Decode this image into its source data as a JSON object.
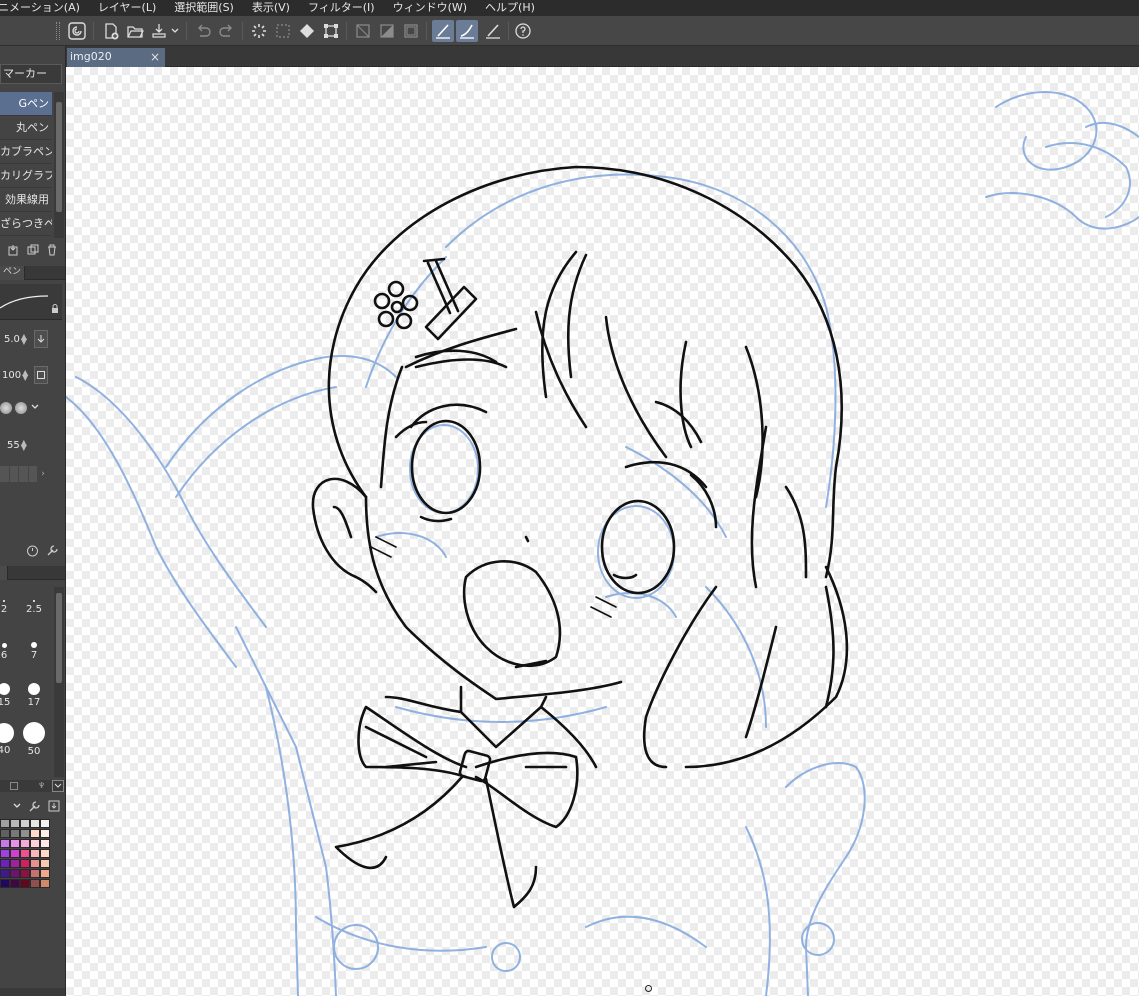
{
  "menubar": {
    "items": [
      "ニメーション(A)",
      "レイヤー(L)",
      "選択範囲(S)",
      "表示(V)",
      "フィルター(I)",
      "ウィンドウ(W)",
      "ヘルプ(H)"
    ]
  },
  "toolbar": {
    "icons": [
      "clip-studio-icon",
      "new-file-icon",
      "open-file-icon",
      "export-icon",
      "undo-icon",
      "redo-icon",
      "clear-icon",
      "selection-icon",
      "fill-icon",
      "transform-icon",
      "invert-selection-icon",
      "layer-mask-icon",
      "border-icon",
      "snap-ruler-icon",
      "snap-special-ruler-icon",
      "snap-grid-icon",
      "help-icon"
    ]
  },
  "subtool": {
    "header": "マーカー",
    "items": [
      "Gペン",
      "丸ペン",
      "カブラペン",
      "カリグラフィ",
      "効果線用",
      "ざらつきペン"
    ],
    "selected_index": 0
  },
  "tool_property": {
    "tab": "ペン",
    "brush_size": "5.0",
    "opacity": "100",
    "stabilization": "55"
  },
  "brush_size_palette": {
    "sizes": [
      "2",
      "2.5",
      "6",
      "7",
      "15",
      "17",
      "40",
      "50"
    ]
  },
  "color_palette": {
    "colors": [
      [
        "#a0a0a0",
        "#b8b8b8",
        "#d0d0d0",
        "#e6e6e6",
        "#f2f2f2"
      ],
      [
        "#606060",
        "#787878",
        "#909090",
        "#ffd8c8",
        "#fff0e6"
      ],
      [
        "#c878e8",
        "#e890e8",
        "#f8a8d8",
        "#ffd0d8",
        "#ffe8e8"
      ],
      [
        "#a040e0",
        "#d040d0",
        "#f05090",
        "#f8b8b8",
        "#ffd8c8"
      ],
      [
        "#7020c0",
        "#a020a0",
        "#d02060",
        "#e89090",
        "#f8c8b0"
      ],
      [
        "#401890",
        "#701070",
        "#901040",
        "#c87070",
        "#f0a888"
      ],
      [
        "#200860",
        "#400840",
        "#600820",
        "#905050",
        "#d08868"
      ]
    ]
  },
  "document": {
    "tab_name": "img020",
    "close_label": "×"
  }
}
